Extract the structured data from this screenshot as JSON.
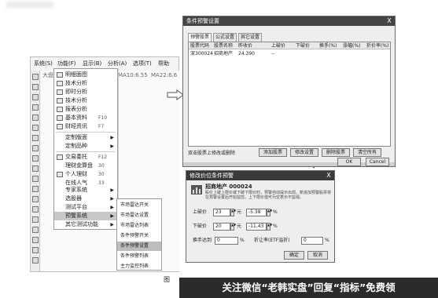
{
  "main_window": {
    "menu": [
      "系统(S)",
      "功能(F)",
      "显示(B)",
      "分析(A)",
      "选项(T)",
      "帮助"
    ],
    "grid_row": [
      "大盘走",
      "MA10:6.55",
      "MA22:6.6"
    ]
  },
  "function_menu": {
    "items": [
      {
        "label": "明细面图",
        "shortcut": "",
        "arrow": false
      },
      {
        "label": "技术分析",
        "shortcut": "",
        "arrow": false
      },
      {
        "label": "即时分析",
        "shortcut": "",
        "arrow": false
      },
      {
        "label": "技术分析",
        "shortcut": "",
        "arrow": false
      },
      {
        "label": "报表分析",
        "shortcut": "",
        "arrow": false
      },
      {
        "label": "基本资料",
        "shortcut": "F10",
        "arrow": false
      },
      {
        "label": "财经资讯",
        "shortcut": "F7",
        "arrow": false
      },
      {
        "label": "定制版面",
        "shortcut": "",
        "arrow": true
      },
      {
        "label": "定制品种",
        "shortcut": "",
        "arrow": true
      },
      {
        "label": "交易委托",
        "shortcut": "F12",
        "arrow": false
      },
      {
        "label": "理财金算盘",
        "shortcut": "30",
        "arrow": false
      },
      {
        "label": "个人理财",
        "shortcut": "30",
        "arrow": false
      },
      {
        "label": "在线人气",
        "shortcut": "33",
        "arrow": false
      },
      {
        "label": "专家系统",
        "shortcut": "",
        "arrow": true
      },
      {
        "label": "选股器",
        "shortcut": "",
        "arrow": true
      },
      {
        "label": "测试平台",
        "shortcut": "",
        "arrow": true
      },
      {
        "label": "预警系统",
        "shortcut": "",
        "arrow": true
      },
      {
        "label": "其它测试功能",
        "shortcut": "",
        "arrow": true
      }
    ]
  },
  "sub_menu": {
    "items": [
      "市场雷达开关",
      "市场雷达设置",
      "市场雷达列表",
      "条件预警开关",
      "条件预警设置",
      "条件预警列表",
      "主力监控列表"
    ],
    "highlighted_index": 4
  },
  "top_dialog": {
    "title": "条件预警设置",
    "close": "X",
    "tabs": [
      "预警股票",
      "公式设置",
      "其它设置"
    ],
    "columns": [
      "股票代码",
      "股票名称",
      "昨收价",
      "上破价",
      "下破价",
      "换手(%)",
      "涨幅(%)",
      "折价率(%)"
    ],
    "row": [
      "深300024",
      "招商地产",
      "24.390",
      "--",
      "",
      "",
      "",
      ""
    ],
    "hint": "双击股票上修改或删除",
    "buttons": [
      "添加股票",
      "修改设置",
      "删除股票",
      "清空所有"
    ],
    "ok": "OK",
    "cancel": "Cancel"
  },
  "bot_dialog": {
    "title": "修改价位条件预警",
    "close": "X",
    "stock": "招商地产 000024",
    "description": "股价上破上限价或下破下限价时，预警自动提示出现。新追加预警股票将在预警设置后开始监控。上下限价值可为空表示不监视。",
    "upper_label": "上破价",
    "upper_value": "23",
    "upper_unit": "元",
    "upper_pct": "-5.38",
    "pct_sign": "%",
    "lower_label": "下破价",
    "lower_value": "20",
    "lower_unit": "元",
    "lower_pct": "-11.43",
    "turnover_label": "换手达到",
    "turnover_value": "0",
    "turnover_unit": "%",
    "discount_label": "折让率(ETF溢折)",
    "discount_value": "0",
    "discount_unit": "%",
    "ok": "确定",
    "cancel": "取消"
  },
  "caption": {
    "fig": "图",
    "text": "关注微信“老韩实盘”回复“指标”免费领"
  }
}
